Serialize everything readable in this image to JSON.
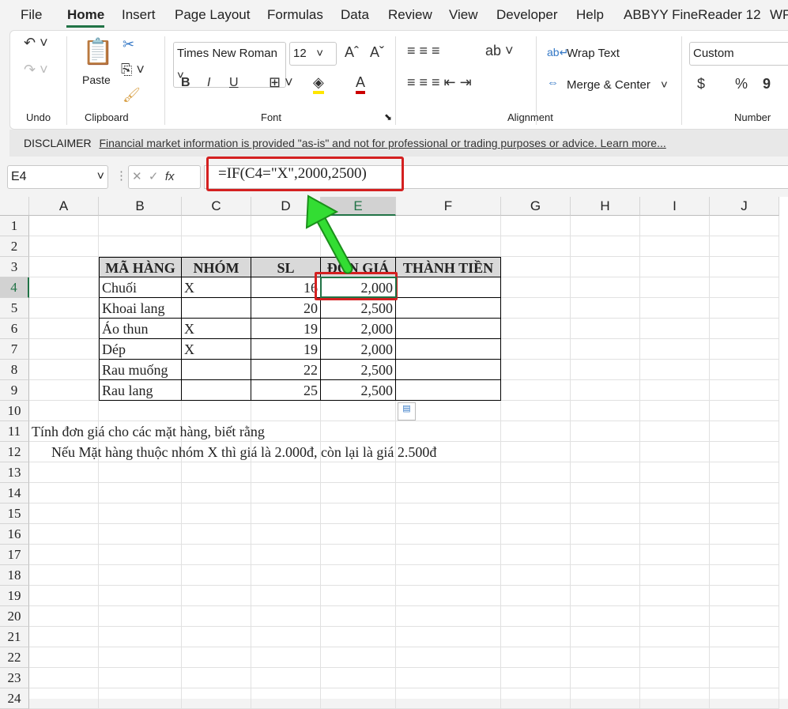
{
  "tabs": [
    "File",
    "Home",
    "Insert",
    "Page Layout",
    "Formulas",
    "Data",
    "Review",
    "View",
    "Developer",
    "Help",
    "ABBYY FineReader 12",
    "WP"
  ],
  "ribbon": {
    "groups": [
      "Undo",
      "Clipboard",
      "Font",
      "Alignment",
      "Number"
    ],
    "paste": "Paste",
    "font_name": "Times New Roman",
    "font_size": "12",
    "wrap_text": "Wrap Text",
    "merge_center": "Merge & Center",
    "number_format": "Custom",
    "bold": "B",
    "italic": "I",
    "underline": "U",
    "currency": "$",
    "percent": "%",
    "comma": "9"
  },
  "disclaimer": {
    "label": "DISCLAIMER",
    "text": "Financial market information is provided \"as-is\" and not for professional or trading purposes or advice. Learn more..."
  },
  "formula_bar": {
    "name_box": "E4",
    "formula": "=IF(C4=\"X\",2000,2500)",
    "fx": "fx"
  },
  "columns": [
    "A",
    "B",
    "C",
    "D",
    "E",
    "F",
    "G",
    "H",
    "I",
    "J"
  ],
  "rows": [
    "1",
    "2",
    "3",
    "4",
    "5",
    "6",
    "7",
    "8",
    "9",
    "10",
    "11",
    "12",
    "13",
    "14",
    "15",
    "16",
    "17",
    "18",
    "19",
    "20",
    "21",
    "22",
    "23",
    "24"
  ],
  "table": {
    "headers": [
      "MÃ HÀNG",
      "NHÓM",
      "SL",
      "ĐƠN GIÁ",
      "THÀNH TIỀN"
    ],
    "rows": [
      [
        "Chuối",
        "X",
        "16",
        "2,000",
        ""
      ],
      [
        "Khoai lang",
        "",
        "20",
        "2,500",
        ""
      ],
      [
        "Áo thun",
        "X",
        "19",
        "2,000",
        ""
      ],
      [
        "Dép",
        "X",
        "19",
        "2,000",
        ""
      ],
      [
        "Rau muống",
        "",
        "22",
        "2,500",
        ""
      ],
      [
        "Rau lang",
        "",
        "25",
        "2,500",
        ""
      ]
    ]
  },
  "notes": [
    "Tính đơn giá cho các mặt hàng, biết rằng",
    "Nếu Mặt hàng thuộc nhóm X thì giá là 2.000đ, còn lại là giá 2.500đ"
  ],
  "colors": {
    "highlight": "#d42020",
    "arrow": "#22cc22",
    "accent": "#217346"
  }
}
